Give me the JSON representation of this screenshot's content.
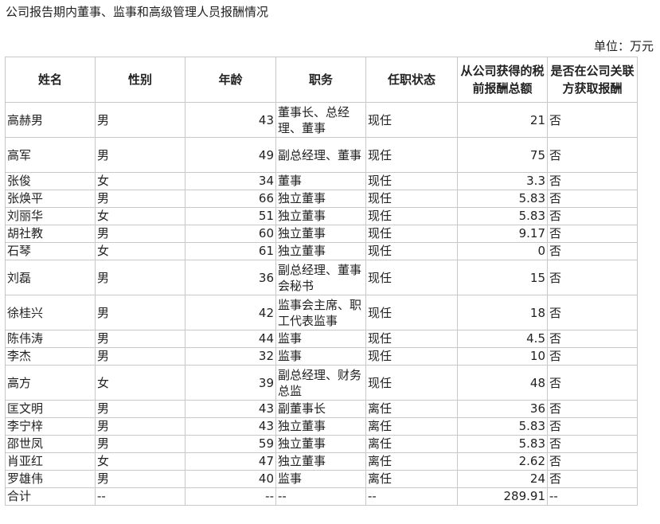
{
  "page": {
    "title": "公司报告期内董事、监事和高级管理人员报酬情况",
    "unit": "单位：万元"
  },
  "table": {
    "headers": {
      "name": "姓名",
      "gender": "性别",
      "age": "年龄",
      "position": "职务",
      "status": "任职状态",
      "pay": "从公司获得的税前报酬总额",
      "related": "是否在公司关联方获取报酬"
    },
    "rows": [
      {
        "name": "高赫男",
        "gender": "男",
        "age": "43",
        "position": "董事长、总经理、董事",
        "status": "现任",
        "pay": "21",
        "related": "否"
      },
      {
        "name": "高军",
        "gender": "男",
        "age": "49",
        "position": "副总经理、董事",
        "status": "现任",
        "pay": "75",
        "related": "否"
      },
      {
        "name": "张俊",
        "gender": "女",
        "age": "34",
        "position": "董事",
        "status": "现任",
        "pay": "3.3",
        "related": "否"
      },
      {
        "name": "张焕平",
        "gender": "男",
        "age": "66",
        "position": "独立董事",
        "status": "现任",
        "pay": "5.83",
        "related": "否"
      },
      {
        "name": "刘丽华",
        "gender": "女",
        "age": "51",
        "position": "独立董事",
        "status": "现任",
        "pay": "5.83",
        "related": "否"
      },
      {
        "name": "胡社教",
        "gender": "男",
        "age": "60",
        "position": "独立董事",
        "status": "现任",
        "pay": "9.17",
        "related": "否"
      },
      {
        "name": "石琴",
        "gender": "女",
        "age": "61",
        "position": "独立董事",
        "status": "现任",
        "pay": "0",
        "related": "否"
      },
      {
        "name": "刘磊",
        "gender": "男",
        "age": "36",
        "position": "副总经理、董事会秘书",
        "status": "现任",
        "pay": "15",
        "related": "否"
      },
      {
        "name": "徐桂兴",
        "gender": "男",
        "age": "42",
        "position": "监事会主席、职工代表监事",
        "status": "现任",
        "pay": "18",
        "related": "否"
      },
      {
        "name": "陈伟涛",
        "gender": "男",
        "age": "44",
        "position": "监事",
        "status": "现任",
        "pay": "4.5",
        "related": "否"
      },
      {
        "name": "李杰",
        "gender": "男",
        "age": "32",
        "position": "监事",
        "status": "现任",
        "pay": "10",
        "related": "否"
      },
      {
        "name": "高方",
        "gender": "女",
        "age": "39",
        "position": "副总经理、财务总监",
        "status": "现任",
        "pay": "48",
        "related": "否"
      },
      {
        "name": "匡文明",
        "gender": "男",
        "age": "43",
        "position": "副董事长",
        "status": "离任",
        "pay": "36",
        "related": "否"
      },
      {
        "name": "李宁梓",
        "gender": "男",
        "age": "43",
        "position": "独立董事",
        "status": "离任",
        "pay": "5.83",
        "related": "否"
      },
      {
        "name": "邵世凤",
        "gender": "男",
        "age": "59",
        "position": "独立董事",
        "status": "离任",
        "pay": "5.83",
        "related": "否"
      },
      {
        "name": "肖亚红",
        "gender": "女",
        "age": "47",
        "position": "独立董事",
        "status": "离任",
        "pay": "2.62",
        "related": "否"
      },
      {
        "name": "罗雄伟",
        "gender": "男",
        "age": "40",
        "position": "监事",
        "status": "离任",
        "pay": "24",
        "related": "否"
      },
      {
        "name": "合计",
        "gender": "--",
        "age": "--",
        "position": "--",
        "status": "--",
        "pay": "289.91",
        "related": "--"
      }
    ]
  }
}
